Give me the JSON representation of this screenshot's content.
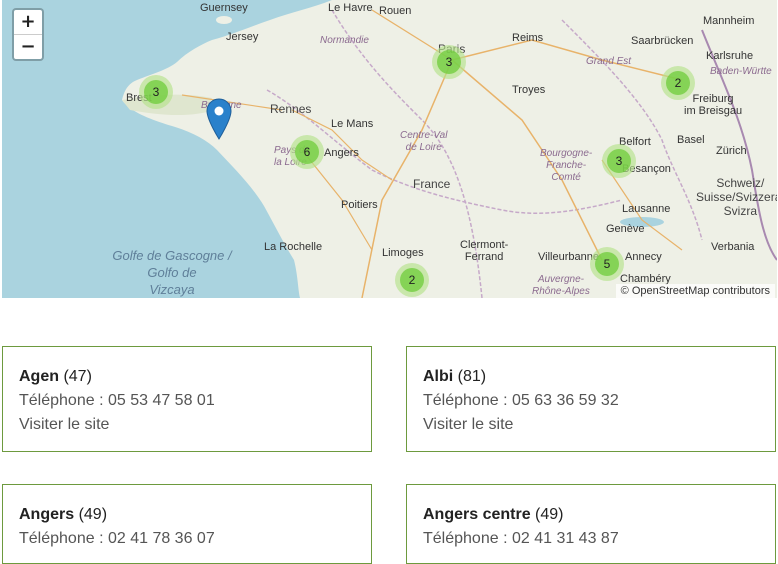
{
  "map": {
    "zoom_in_label": "+",
    "zoom_out_label": "−",
    "attribution": "© OpenStreetMap contributors",
    "places": {
      "guernsey": "Guernsey",
      "jersey": "Jersey",
      "le_havre": "Le Havre",
      "rouen": "Rouen",
      "normandie": "Normandie",
      "paris": "Paris",
      "reims": "Reims",
      "mannheim": "Mannheim",
      "saarbrucken": "Saarbrücken",
      "karlsruhe": "Karlsruhe",
      "grand_est": "Grand Est",
      "baden": "Baden-Württe",
      "brest": "Brest",
      "bretagne": "Bretagne",
      "rennes": "Rennes",
      "le_mans": "Le Mans",
      "troyes": "Troyes",
      "freiburg": "Freiburg\nim Breisgau",
      "basel": "Basel",
      "zurich": "Zürich",
      "belfort": "Belfort",
      "angers": "Angers",
      "pays_loire": "Pays de la Loire",
      "centre": "Centre-Val\nde Loire",
      "bourgogne": "Bourgogne-\nFranche-\nComté",
      "besancon": "Besançon",
      "france": "France",
      "schweiz": "Schweiz/\nSuisse/Svizzera/\nSvizra",
      "poitiers": "Poitiers",
      "lausanne": "Lausanne",
      "geneve": "Genève",
      "sea": "Golfe de Gascogne /\nGolfo de\nVizcaya",
      "la_rochelle": "La Rochelle",
      "limoges": "Limoges",
      "clermont": "Clermont-\nFerrand",
      "villeurbanne": "Villeurbanne",
      "annecy": "Annecy",
      "verbania": "Verbania",
      "auvergne": "Auvergne-\nRhône-Alpes",
      "chambery": "Chambéry"
    },
    "clusters": [
      {
        "count": "3"
      },
      {
        "count": "3"
      },
      {
        "count": "2"
      },
      {
        "count": "6"
      },
      {
        "count": "3"
      },
      {
        "count": "5"
      },
      {
        "count": "2"
      }
    ]
  },
  "cards": [
    {
      "name": "Agen",
      "code": "(47)",
      "phone": "Téléphone : 05 53 47 58 01",
      "link": "Visiter le site"
    },
    {
      "name": "Albi",
      "code": "(81)",
      "phone": "Téléphone : 05 63 36 59 32",
      "link": "Visiter le site"
    },
    {
      "name": "Angers",
      "code": "(49)",
      "phone": "Téléphone : 02 41 78 36 07",
      "link": ""
    },
    {
      "name": "Angers centre",
      "code": "(49)",
      "phone": "Téléphone : 02 41 31 43 87",
      "link": ""
    }
  ],
  "colors": {
    "card_border": "#6d9a3e",
    "cluster_outer": "#b5e28c",
    "cluster_inner": "#6ecc39",
    "pin": "#2a81cb",
    "sea": "#aad3df"
  }
}
